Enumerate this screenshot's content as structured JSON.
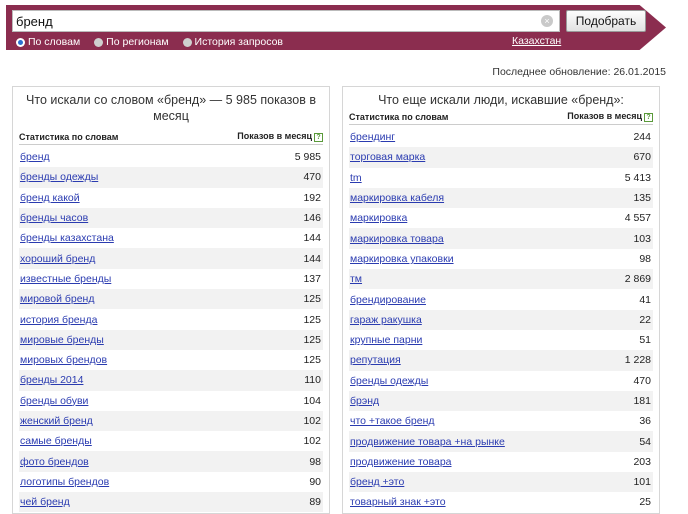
{
  "search": {
    "value": "бренд",
    "button": "Подобрать"
  },
  "modes": [
    {
      "label": "По словам",
      "selected": true
    },
    {
      "label": "По регионам",
      "selected": false
    },
    {
      "label": "История запросов",
      "selected": false
    }
  ],
  "region": "Казахстан",
  "updated": "Последнее обновление: 26.01.2015",
  "left": {
    "title": "Что искали со словом «бренд» — 5 985 показов в месяц",
    "col_word": "Статистика по словам",
    "col_count": "Показов в месяц",
    "rows": [
      {
        "q": "бренд",
        "n": "5 985"
      },
      {
        "q": "бренды одежды",
        "n": "470"
      },
      {
        "q": "бренд какой",
        "n": "192"
      },
      {
        "q": "бренды часов",
        "n": "146"
      },
      {
        "q": "бренды казахстана",
        "n": "144"
      },
      {
        "q": "хороший бренд",
        "n": "144"
      },
      {
        "q": "известные бренды",
        "n": "137"
      },
      {
        "q": "мировой бренд",
        "n": "125"
      },
      {
        "q": "история бренда",
        "n": "125"
      },
      {
        "q": "мировые бренды",
        "n": "125"
      },
      {
        "q": "мировых брендов",
        "n": "125"
      },
      {
        "q": "бренды 2014",
        "n": "110"
      },
      {
        "q": "бренды обуви",
        "n": "104"
      },
      {
        "q": "женский бренд",
        "n": "102"
      },
      {
        "q": "самые бренды",
        "n": "102"
      },
      {
        "q": "фото брендов",
        "n": "98"
      },
      {
        "q": "логотипы брендов",
        "n": "90"
      },
      {
        "q": "чей бренд",
        "n": "89"
      }
    ]
  },
  "right": {
    "title": "Что еще искали люди, искавшие «бренд»:",
    "col_word": "Статистика по словам",
    "col_count": "Показов в месяц",
    "rows": [
      {
        "q": "брендинг",
        "n": "244"
      },
      {
        "q": "торговая марка",
        "n": "670"
      },
      {
        "q": "tm",
        "n": "5 413"
      },
      {
        "q": "маркировка кабеля",
        "n": "135"
      },
      {
        "q": "маркировка",
        "n": "4 557"
      },
      {
        "q": "маркировка товара",
        "n": "103"
      },
      {
        "q": "маркировка упаковки",
        "n": "98"
      },
      {
        "q": "тм",
        "n": "2 869"
      },
      {
        "q": "брендирование",
        "n": "41"
      },
      {
        "q": "гараж ракушка",
        "n": "22"
      },
      {
        "q": "крупные парни",
        "n": "51"
      },
      {
        "q": "репутация",
        "n": "1 228"
      },
      {
        "q": "бренды одежды",
        "n": "470"
      },
      {
        "q": "брэнд",
        "n": "181"
      },
      {
        "q": "что +такое бренд",
        "n": "36"
      },
      {
        "q": "продвижение товара +на рынке",
        "n": "54"
      },
      {
        "q": "продвижение товара",
        "n": "203"
      },
      {
        "q": "бренд +это",
        "n": "101"
      },
      {
        "q": "товарный знак +это",
        "n": "25"
      }
    ]
  }
}
